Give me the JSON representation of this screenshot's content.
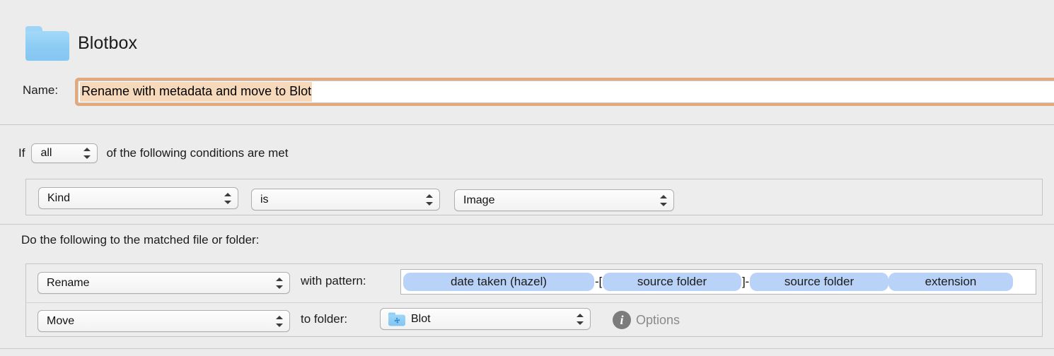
{
  "window": {
    "folder_icon": "folder-icon",
    "title": "Blotbox"
  },
  "name_row": {
    "label": "Name:",
    "value": "Rename with metadata and move to Blot",
    "selected": true
  },
  "conditions": {
    "if_word": "If",
    "match_mode": "all",
    "trailing_text": "of the following conditions are met",
    "rows": [
      {
        "attribute": "Kind",
        "operator": "is",
        "value": "Image"
      }
    ]
  },
  "actions": {
    "header": "Do the following to the matched file or folder:",
    "rows": [
      {
        "action": "Rename",
        "label": "with pattern:",
        "pattern_tokens": [
          {
            "type": "token",
            "text": "date taken (hazel)"
          },
          {
            "type": "literal",
            "text": "-["
          },
          {
            "type": "token",
            "text": "source folder"
          },
          {
            "type": "literal",
            "text": "]-"
          },
          {
            "type": "token",
            "text": "source folder"
          },
          {
            "type": "token",
            "text": "extension"
          }
        ]
      },
      {
        "action": "Move",
        "label": "to folder:",
        "folder_icon": "folder-puzzle-icon",
        "folder": "Blot",
        "options_icon": "info-icon",
        "options_label": "Options"
      }
    ]
  },
  "colors": {
    "background": "#ececec",
    "token_blue": "#b9d2f7",
    "focus_ring": "#e3a87c",
    "selection": "#f6d8ba",
    "panel": "#ededed",
    "divider": "#c8c8c8"
  }
}
